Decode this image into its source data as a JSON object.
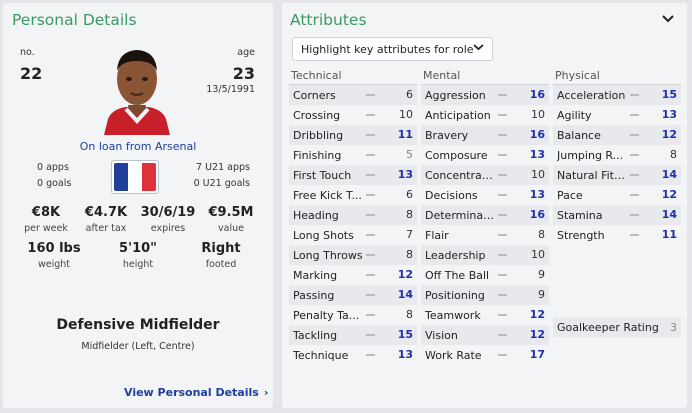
{
  "personal": {
    "title": "Personal Details",
    "no_label": "no.",
    "number": "22",
    "age_label": "age",
    "age": "23",
    "dob": "13/5/1991",
    "loan": "On loan from Arsenal",
    "apps_left": "0 apps",
    "goals_left": "0 goals",
    "apps_right": "7 U21 apps",
    "goals_right": "0 U21 goals",
    "stats": [
      {
        "value": "€8K",
        "label": "per week"
      },
      {
        "value": "€4.7K",
        "label": "after tax"
      },
      {
        "value": "30/6/19",
        "label": "expires"
      },
      {
        "value": "€9.5M",
        "label": "value"
      }
    ],
    "body": [
      {
        "value": "160 lbs",
        "label": "weight"
      },
      {
        "value": "5'10\"",
        "label": "height"
      },
      {
        "value": "Right",
        "label": "footed"
      }
    ],
    "role": "Defensive Midfielder",
    "role_sub": "Midfielder (Left, Centre)",
    "view_link": "View Personal Details",
    "flag_colors": [
      "#1f3f9a",
      "#ffffff",
      "#e0303a"
    ]
  },
  "attributes": {
    "title": "Attributes",
    "dropdown": "Highlight key attributes for role",
    "columns": [
      {
        "heading": "Technical",
        "items": [
          {
            "name": "Corners",
            "value": "6",
            "level": "mid"
          },
          {
            "name": "Crossing",
            "value": "10",
            "level": "mid"
          },
          {
            "name": "Dribbling",
            "value": "11",
            "level": "high"
          },
          {
            "name": "Finishing",
            "value": "5",
            "level": "low"
          },
          {
            "name": "First Touch",
            "value": "13",
            "level": "high"
          },
          {
            "name": "Free Kick T...",
            "value": "6",
            "level": "mid"
          },
          {
            "name": "Heading",
            "value": "8",
            "level": "mid"
          },
          {
            "name": "Long Shots",
            "value": "7",
            "level": "mid"
          },
          {
            "name": "Long Throws",
            "value": "8",
            "level": "mid"
          },
          {
            "name": "Marking",
            "value": "12",
            "level": "high"
          },
          {
            "name": "Passing",
            "value": "14",
            "level": "high"
          },
          {
            "name": "Penalty Ta...",
            "value": "8",
            "level": "mid"
          },
          {
            "name": "Tackling",
            "value": "15",
            "level": "high"
          },
          {
            "name": "Technique",
            "value": "13",
            "level": "high"
          }
        ]
      },
      {
        "heading": "Mental",
        "items": [
          {
            "name": "Aggression",
            "value": "16",
            "level": "high"
          },
          {
            "name": "Anticipation",
            "value": "10",
            "level": "mid"
          },
          {
            "name": "Bravery",
            "value": "16",
            "level": "high"
          },
          {
            "name": "Composure",
            "value": "13",
            "level": "high"
          },
          {
            "name": "Concentrati...",
            "value": "10",
            "level": "mid"
          },
          {
            "name": "Decisions",
            "value": "13",
            "level": "high"
          },
          {
            "name": "Determinat...",
            "value": "16",
            "level": "high"
          },
          {
            "name": "Flair",
            "value": "8",
            "level": "mid"
          },
          {
            "name": "Leadership",
            "value": "10",
            "level": "mid"
          },
          {
            "name": "Off The Ball",
            "value": "9",
            "level": "mid"
          },
          {
            "name": "Positioning",
            "value": "9",
            "level": "mid"
          },
          {
            "name": "Teamwork",
            "value": "12",
            "level": "high"
          },
          {
            "name": "Vision",
            "value": "12",
            "level": "high"
          },
          {
            "name": "Work Rate",
            "value": "17",
            "level": "high"
          }
        ]
      },
      {
        "heading": "Physical",
        "items": [
          {
            "name": "Acceleration",
            "value": "15",
            "level": "high"
          },
          {
            "name": "Agility",
            "value": "13",
            "level": "high"
          },
          {
            "name": "Balance",
            "value": "12",
            "level": "high"
          },
          {
            "name": "Jumping R...",
            "value": "8",
            "level": "mid"
          },
          {
            "name": "Natural Fitn...",
            "value": "14",
            "level": "high"
          },
          {
            "name": "Pace",
            "value": "12",
            "level": "high"
          },
          {
            "name": "Stamina",
            "value": "14",
            "level": "high"
          },
          {
            "name": "Strength",
            "value": "11",
            "level": "high"
          }
        ]
      }
    ],
    "goalkeeper": {
      "name": "Goalkeeper Rating",
      "value": "3"
    }
  }
}
